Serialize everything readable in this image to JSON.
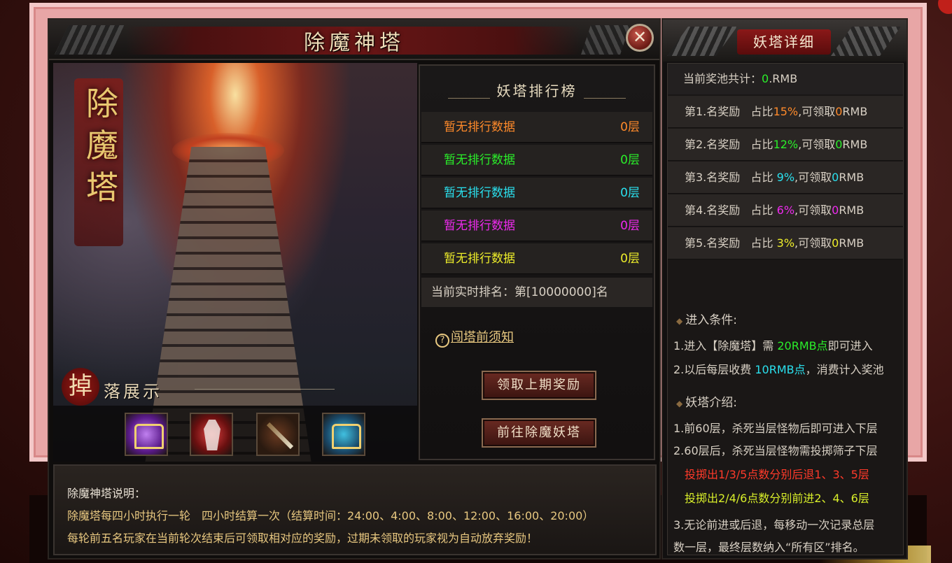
{
  "main": {
    "title": "除魔神塔",
    "art_calligraphy": [
      "除",
      "魔",
      "塔"
    ],
    "drop_seal": "掉",
    "drop_title": "落展示",
    "drop_items": [
      "purple-treasure-chest",
      "red-armor-set",
      "flame-sword",
      "blue-treasure-chest"
    ]
  },
  "ranking": {
    "header": "妖塔排行榜",
    "rows": [
      {
        "name": "暂无排行数据",
        "floor": "0层",
        "color": "#ff8a2a"
      },
      {
        "name": "暂无排行数据",
        "floor": "0层",
        "color": "#2aee2a"
      },
      {
        "name": "暂无排行数据",
        "floor": "0层",
        "color": "#2ae0ee"
      },
      {
        "name": "暂无排行数据",
        "floor": "0层",
        "color": "#ee2aee"
      },
      {
        "name": "暂无排行数据",
        "floor": "0层",
        "color": "#eeee2a"
      }
    ],
    "current_rank": "当前实时排名：第[10000000]名",
    "notice_icon": "?",
    "notice": "闯塔前须知",
    "claim_button": "领取上期奖励",
    "goto_button": "前往除魔妖塔"
  },
  "description": {
    "heading": "除魔神塔说明：",
    "line1": "除魔塔每四小时执行一轮　四小时结算一次（结算时间：24:00、4:00、8:00、12:00、16:00、20:00）",
    "line2": "每轮前五名玩家在当前轮次结束后可领取相对应的奖励，过期未领取的玩家视为自动放弃奖励！"
  },
  "detail": {
    "title": "妖塔详细",
    "pool_label": "当前奖池共计：",
    "pool_value": "0",
    "pool_unit": ".RMB",
    "rewards": [
      {
        "rank": "第1.名奖励",
        "share_label": "占比",
        "percent": "15%",
        "claim": ",可领取",
        "amount": "0",
        "unit": "RMB",
        "color": "#ff8a2a"
      },
      {
        "rank": "第2.名奖励",
        "share_label": "占比",
        "percent": "12%",
        "claim": ",可领取",
        "amount": "0",
        "unit": "RMB",
        "color": "#2aee2a"
      },
      {
        "rank": "第3.名奖励",
        "share_label": "占比 ",
        "percent": "9%",
        "claim": ",可领取",
        "amount": "0",
        "unit": "RMB",
        "color": "#2ae0ee"
      },
      {
        "rank": "第4.名奖励",
        "share_label": "占比 ",
        "percent": "6%",
        "claim": ",可领取",
        "amount": "0",
        "unit": "RMB",
        "color": "#ee2aee"
      },
      {
        "rank": "第5.名奖励",
        "share_label": "占比 ",
        "percent": "3%",
        "claim": ",可领取",
        "amount": "0",
        "unit": "RMB",
        "color": "#eeee2a"
      }
    ],
    "entry_heading": "进入条件:",
    "entry1_pre": "1.进入【除魔塔】需 ",
    "entry1_val": "20RMB点",
    "entry1_post": "即可进入",
    "entry2_pre": "2.以后每层收费 ",
    "entry2_val": "10RMB点",
    "entry2_post": "，消费计入奖池",
    "intro_heading": "妖塔介绍:",
    "intro1": "1.前60层，杀死当层怪物后即可进入下层",
    "intro2": "2.60层后，杀死当层怪物需投掷筛子下层",
    "intro3": "投掷出1/3/5点数分别后退1、3、5层",
    "intro4": "投掷出2/4/6点数分别前进2、4、6层",
    "intro5": "3.无论前进或后退，每移动一次记录总层",
    "intro6": "数一层，最终层数纳入“所有区”排名。",
    "colors": {
      "green": "#2aee2a",
      "cyan": "#2ae0ee",
      "red": "#ff3a2a",
      "yellow": "#d8ee2a"
    }
  }
}
